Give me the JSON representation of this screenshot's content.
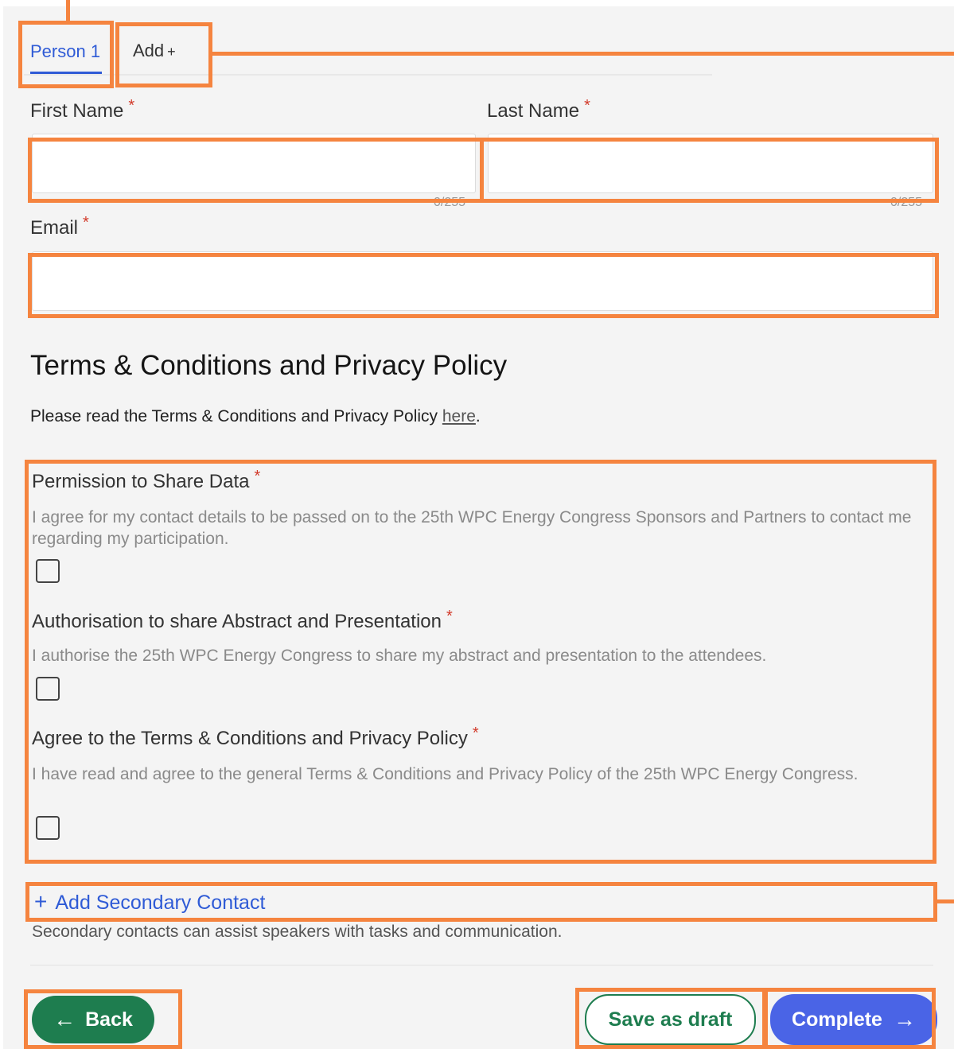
{
  "tabs": {
    "person_label": "Person 1",
    "add_label": "Add",
    "add_plus": "+"
  },
  "fields": {
    "first_name": {
      "label": "First Name",
      "required": "*",
      "value": "",
      "counter": "0/255"
    },
    "last_name": {
      "label": "Last Name",
      "required": "*",
      "value": "",
      "counter": "0/255"
    },
    "email": {
      "label": "Email",
      "required": "*",
      "value": ""
    }
  },
  "terms": {
    "heading": "Terms & Conditions and Privacy Policy",
    "intro_text": "Please read the Terms & Conditions and Privacy Policy",
    "intro_link": "here",
    "intro_end": "."
  },
  "consents": [
    {
      "label": "Permission to Share Data",
      "required": "*",
      "description": "I agree for my contact details to be passed on to the 25th WPC Energy Congress Sponsors and Partners to contact me regarding my participation.",
      "checked": false
    },
    {
      "label": "Authorisation to share Abstract and Presentation",
      "required": "*",
      "description": "I authorise the 25th WPC Energy Congress to share my abstract and presentation to the attendees.",
      "checked": false
    },
    {
      "label": "Agree to the Terms & Conditions and Privacy Policy",
      "required": "*",
      "description": "I have read and agree to the general Terms & Conditions and Privacy Policy of the 25th WPC Energy Congress.",
      "checked": false
    }
  ],
  "secondary": {
    "add_label": "Add Secondary Contact",
    "plus": "+",
    "description": "Secondary contacts can assist speakers with tasks and communication."
  },
  "actions": {
    "back_label": "Back",
    "back_arrow": "←",
    "draft_label": "Save as draft",
    "complete_label": "Complete",
    "complete_arrow": "→"
  },
  "colors": {
    "annotation": "#f5843f",
    "primary_blue": "#2f5bd6",
    "green": "#1e7d4f",
    "complete_blue": "#4a64e6",
    "required_red": "#d23a2a"
  }
}
